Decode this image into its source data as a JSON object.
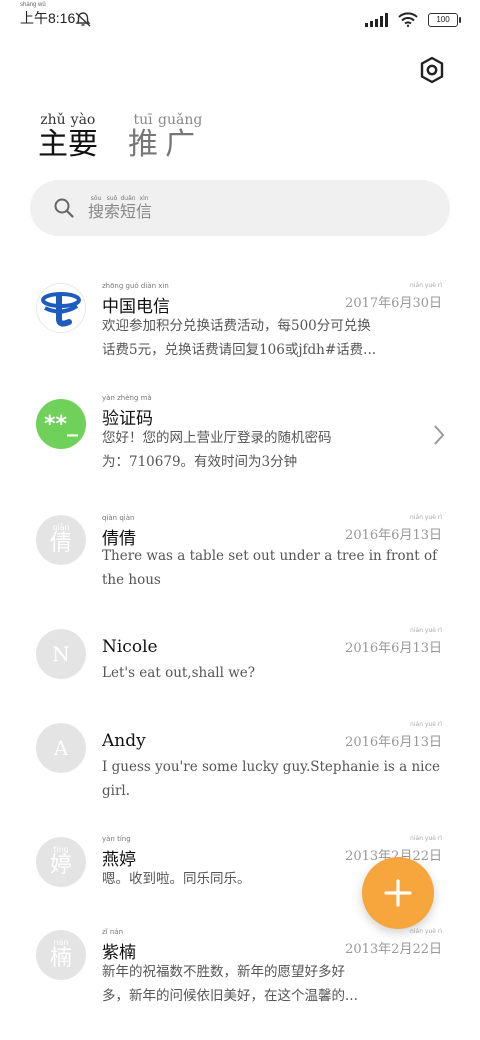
{
  "status_bar": {
    "time_pinyin": "shàng wǔ",
    "time": "上午8:16",
    "battery": "100"
  },
  "tabs": [
    {
      "label": "主要",
      "pinyin": [
        "zhǔ",
        "yào"
      ],
      "chars": [
        "主",
        "要"
      ],
      "active": true
    },
    {
      "label": "推广",
      "pinyin": [
        "tuī",
        "guǎng"
      ],
      "chars": [
        "推",
        "广"
      ],
      "active": false
    }
  ],
  "search": {
    "placeholder": "搜索短信",
    "chars": [
      "搜",
      "索",
      "短",
      "信"
    ],
    "pinyin": [
      "sōu",
      "suǒ",
      "duǎn",
      "xìn"
    ]
  },
  "messages": [
    {
      "name": "中国电信",
      "name_pinyin": "zhōng guó diàn xìn",
      "date": "2017年6月30日",
      "date_pinyin": "nián yuè rì",
      "preview_line1": "欢迎参加积分兑换话费活动，每500分可兑换",
      "preview_line2": "话费5元，兑换话费请回复106或jfdh#话费...",
      "avatar": "china-telecom-logo"
    },
    {
      "name": "验证码",
      "name_pinyin": "yàn zhèng mǎ",
      "date": "",
      "preview_line1": "您好！您的网上营业厅登录的随机密码",
      "preview_line2": "为：710679。有效时间为3分钟",
      "avatar_text": "**_"
    },
    {
      "name": "倩倩",
      "name_pinyin": "qiàn qiàn",
      "date": "2016年6月13日",
      "date_pinyin": "nián yuè rì",
      "preview_line1": "There was a table set out under a tree in front of",
      "preview_line2": "the hous",
      "avatar_text": "倩",
      "avatar_pinyin": "qiàn"
    },
    {
      "name": "Nicole",
      "date": "2016年6月13日",
      "date_pinyin": "nián yuè rì",
      "preview_line1": "Let's eat out,shall we?",
      "preview_line2": "",
      "avatar_text": "N"
    },
    {
      "name": "Andy",
      "date": "2016年6月13日",
      "date_pinyin": "nián yuè rì",
      "preview_line1": "I guess you're some lucky guy.Stephanie is a nice",
      "preview_line2": "girl.",
      "avatar_text": "A"
    },
    {
      "name": "燕婷",
      "name_pinyin": "yàn tíng",
      "date": "2013年2月22日",
      "date_pinyin": "nián yuè rì",
      "preview_line1": "嗯。收到啦。同乐同乐。",
      "preview_line2": "",
      "avatar_text": "婷",
      "avatar_pinyin": "tíng"
    },
    {
      "name": "紫楠",
      "name_pinyin": "zǐ nán",
      "date": "2013年2月22日",
      "date_pinyin": "nián yuè rì",
      "preview_line1": "新年的祝福数不胜数，新年的愿望好多好",
      "preview_line2": "多，新年的问候依旧美好，在这个温馨的...",
      "avatar_text": "楠",
      "avatar_pinyin": "nán"
    }
  ],
  "fab": {
    "label": "+"
  },
  "colors": {
    "accent": "#f7a53d",
    "code_avatar": "#6fd05a",
    "telecom_blue": "#1d5bbd",
    "default_avatar": "#e4e4e4"
  }
}
